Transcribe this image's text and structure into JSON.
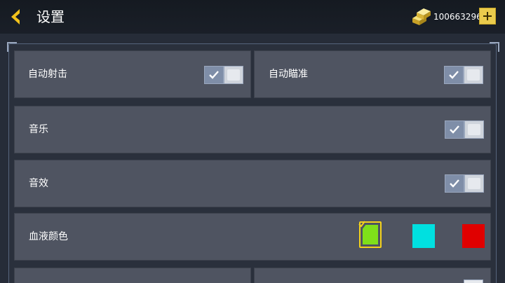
{
  "header": {
    "title": "设置",
    "currency_value": "100663296"
  },
  "settings": {
    "auto_fire": {
      "label": "自动射击",
      "enabled": true
    },
    "auto_aim": {
      "label": "自动瞄准",
      "enabled": true
    },
    "music": {
      "label": "音乐",
      "enabled": true
    },
    "sound_effects": {
      "label": "音效",
      "enabled": true
    },
    "blood_color": {
      "label": "血液颜色",
      "options": [
        "#7fe01a",
        "#00e0e0",
        "#e00000"
      ],
      "selected_index": 0
    }
  },
  "colors": {
    "accent": "#f2c21b",
    "panel": "#4f5461",
    "background": "#262c38"
  },
  "icons": {
    "back": "back-arrow-icon",
    "currency": "gold-bars-icon",
    "add": "plus-icon",
    "check": "check-icon"
  }
}
